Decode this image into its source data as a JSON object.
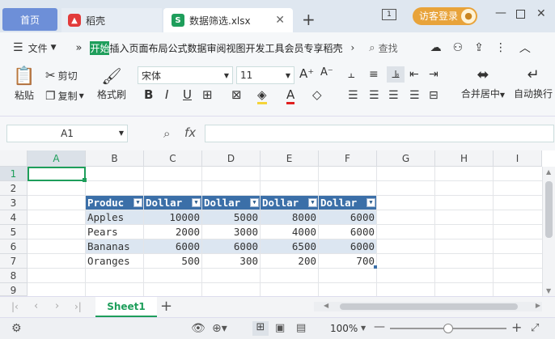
{
  "titlebar": {
    "home_tab": "首页",
    "daoke_tab": "稻壳",
    "file_tab": "数据筛选.xlsx",
    "visitor_login": "访客登录"
  },
  "menu": {
    "file": "文件",
    "items": "开始插入页面布局公式数据审阅视图开发工具会员专享稻壳",
    "active": "开始",
    "search": "查找"
  },
  "ribbon": {
    "paste": "粘贴",
    "cut": "剪切",
    "copy": "复制",
    "format_painter": "格式刷",
    "font_name": "宋体",
    "font_size": "11",
    "merge": "合并居中",
    "autowrap": "自动换行"
  },
  "formula_bar": {
    "cell_ref": "A1",
    "fx": "fx",
    "value": ""
  },
  "grid": {
    "columns": [
      "A",
      "B",
      "C",
      "D",
      "E",
      "F",
      "G",
      "H",
      "I"
    ],
    "rows": [
      "1",
      "2",
      "3",
      "4",
      "5",
      "6",
      "7",
      "8",
      "9"
    ],
    "table_headers": [
      "Produc",
      "Dollar",
      "Dollar",
      "Dollar",
      "Dollar"
    ],
    "table_rows": [
      [
        "Apples",
        "10000",
        "5000",
        "8000",
        "6000"
      ],
      [
        "Pears",
        "2000",
        "3000",
        "4000",
        "6000"
      ],
      [
        "Bananas",
        "6000",
        "6000",
        "6500",
        "6000"
      ],
      [
        "Oranges",
        "500",
        "300",
        "200",
        "700"
      ]
    ]
  },
  "sheets": {
    "active": "Sheet1"
  },
  "statusbar": {
    "zoom": "100%"
  },
  "colors": {
    "accent": "#1e9e5b",
    "table_header": "#3b6fa8",
    "table_band": "#dce6f1",
    "login": "#e8a33a"
  }
}
